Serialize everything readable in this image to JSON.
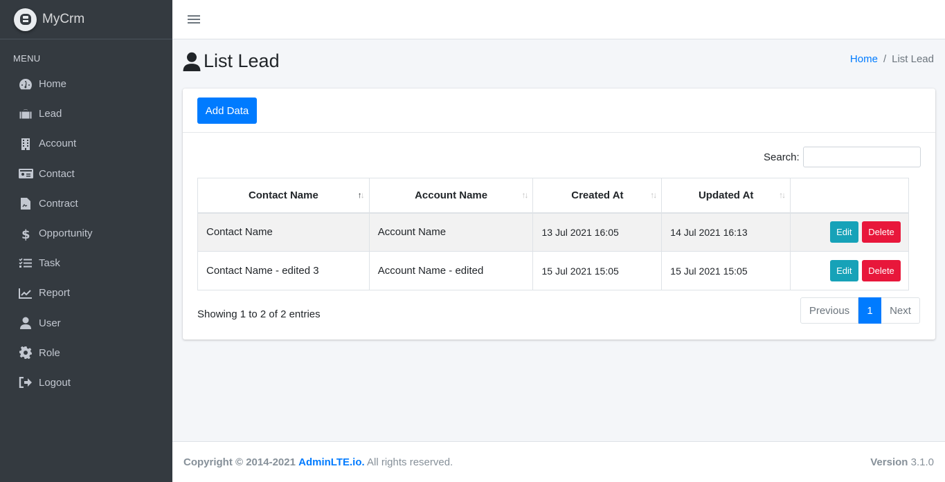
{
  "brand": {
    "name": "MyCrm",
    "logo_icon": "logo-icon"
  },
  "sidebar": {
    "header": "MENU",
    "items": [
      {
        "label": "Home",
        "icon": "dashboard-icon"
      },
      {
        "label": "Lead",
        "icon": "briefcase-icon"
      },
      {
        "label": "Account",
        "icon": "building-icon"
      },
      {
        "label": "Contact",
        "icon": "id-card-icon"
      },
      {
        "label": "Contract",
        "icon": "file-contract-icon"
      },
      {
        "label": "Opportunity",
        "icon": "dollar-icon"
      },
      {
        "label": "Task",
        "icon": "tasks-icon"
      },
      {
        "label": "Report",
        "icon": "chart-line-icon"
      },
      {
        "label": "User",
        "icon": "user-icon"
      },
      {
        "label": "Role",
        "icon": "cog-icon"
      },
      {
        "label": "Logout",
        "icon": "sign-out-icon"
      }
    ]
  },
  "header": {
    "title": "List Lead",
    "breadcrumb": {
      "home": "Home",
      "separator": "/",
      "current": "List Lead"
    }
  },
  "toolbar": {
    "add_label": "Add Data"
  },
  "search": {
    "label": "Search:",
    "value": ""
  },
  "table": {
    "columns": [
      "Contact Name",
      "Account Name",
      "Created At",
      "Updated At",
      ""
    ],
    "sort_icon": "↑↓",
    "rows": [
      {
        "contact": "Contact Name",
        "account": "Account Name",
        "created": "13 Jul 2021 16:05",
        "updated": "14 Jul 2021 16:13",
        "edit": "Edit",
        "delete": "Delete"
      },
      {
        "contact": "Contact Name - edited 3",
        "account": "Account Name - edited",
        "created": "15 Jul 2021 15:05",
        "updated": "15 Jul 2021 15:05",
        "edit": "Edit",
        "delete": "Delete"
      }
    ]
  },
  "pagination": {
    "info": "Showing 1 to 2 of 2 entries",
    "previous": "Previous",
    "page": "1",
    "next": "Next"
  },
  "footer": {
    "copyright": "Copyright © 2014-2021",
    "brand_link": "AdminLTE.io.",
    "rights": "All rights reserved.",
    "version_label": "Version",
    "version": "3.1.0"
  },
  "colors": {
    "primary": "#007bff",
    "info": "#17a2b8",
    "danger": "#e8173b",
    "sidebar": "#343a40"
  }
}
